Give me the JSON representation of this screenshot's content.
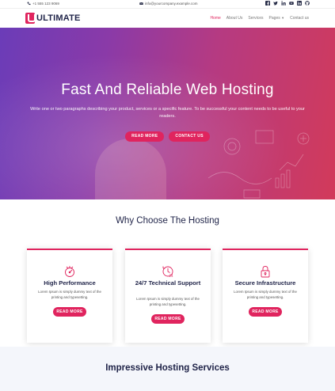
{
  "topbar": {
    "phone": "+1 555 123 9069",
    "email": "info@yourcompany.example.com",
    "socials": [
      "facebook-icon",
      "twitter-icon",
      "linkedin-icon",
      "youtube-icon",
      "linkedin-square-icon",
      "github-icon"
    ]
  },
  "nav": {
    "logo_text": "ULTIMATE",
    "items": [
      "Home",
      "About Us",
      "Services",
      "Pages",
      "Contact us"
    ],
    "active": "Home"
  },
  "hero": {
    "title": "Fast And Reliable Web Hosting",
    "subtitle": "Write one or two paragraphs describing your product, services or a specific feature.  To be successful your content needs to be useful to your readers.",
    "btn_primary": "READ MORE",
    "btn_secondary": "CONTACT US"
  },
  "why": {
    "title": "Why Choose The Hosting",
    "cards": [
      {
        "title": "High Performance",
        "text": "Lorem Ipsum is simply dummy text of the printing and typesetting.",
        "btn": "READ MORE",
        "icon": "performance-icon"
      },
      {
        "title": "24/7 Technical Support",
        "text": "Lorem Ipsum is simply dummy text of the printing and typesetting.",
        "btn": "READ MORE",
        "icon": "support-24-icon"
      },
      {
        "title": "Secure Infrastructure",
        "text": "Lorem Ipsum is simply dummy text of the printing and typesetting.",
        "btn": "READ MORE",
        "icon": "lock-icon"
      }
    ]
  },
  "lower": {
    "title": "Impressive Hosting Services"
  },
  "colors": {
    "accent": "#e0245e",
    "heading": "#1f2348",
    "hero_start": "#6b3cb8",
    "hero_end": "#d23a5a"
  }
}
